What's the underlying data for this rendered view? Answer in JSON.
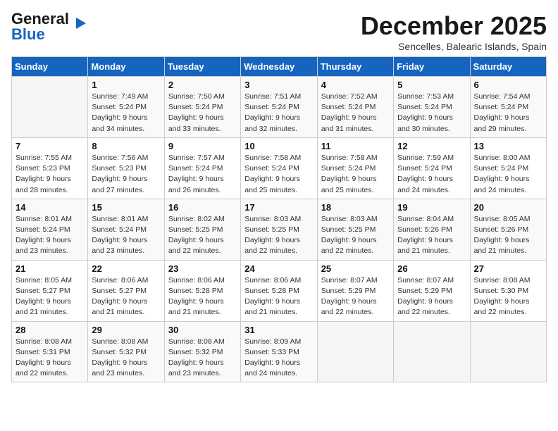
{
  "header": {
    "logo_general": "General",
    "logo_blue": "Blue",
    "title": "December 2025",
    "subtitle": "Sencelles, Balearic Islands, Spain"
  },
  "calendar": {
    "days_of_week": [
      "Sunday",
      "Monday",
      "Tuesday",
      "Wednesday",
      "Thursday",
      "Friday",
      "Saturday"
    ],
    "weeks": [
      [
        {
          "date": "",
          "info": ""
        },
        {
          "date": "1",
          "info": "Sunrise: 7:49 AM\nSunset: 5:24 PM\nDaylight: 9 hours\nand 34 minutes."
        },
        {
          "date": "2",
          "info": "Sunrise: 7:50 AM\nSunset: 5:24 PM\nDaylight: 9 hours\nand 33 minutes."
        },
        {
          "date": "3",
          "info": "Sunrise: 7:51 AM\nSunset: 5:24 PM\nDaylight: 9 hours\nand 32 minutes."
        },
        {
          "date": "4",
          "info": "Sunrise: 7:52 AM\nSunset: 5:24 PM\nDaylight: 9 hours\nand 31 minutes."
        },
        {
          "date": "5",
          "info": "Sunrise: 7:53 AM\nSunset: 5:24 PM\nDaylight: 9 hours\nand 30 minutes."
        },
        {
          "date": "6",
          "info": "Sunrise: 7:54 AM\nSunset: 5:24 PM\nDaylight: 9 hours\nand 29 minutes."
        }
      ],
      [
        {
          "date": "7",
          "info": "Sunrise: 7:55 AM\nSunset: 5:23 PM\nDaylight: 9 hours\nand 28 minutes."
        },
        {
          "date": "8",
          "info": "Sunrise: 7:56 AM\nSunset: 5:23 PM\nDaylight: 9 hours\nand 27 minutes."
        },
        {
          "date": "9",
          "info": "Sunrise: 7:57 AM\nSunset: 5:24 PM\nDaylight: 9 hours\nand 26 minutes."
        },
        {
          "date": "10",
          "info": "Sunrise: 7:58 AM\nSunset: 5:24 PM\nDaylight: 9 hours\nand 25 minutes."
        },
        {
          "date": "11",
          "info": "Sunrise: 7:58 AM\nSunset: 5:24 PM\nDaylight: 9 hours\nand 25 minutes."
        },
        {
          "date": "12",
          "info": "Sunrise: 7:59 AM\nSunset: 5:24 PM\nDaylight: 9 hours\nand 24 minutes."
        },
        {
          "date": "13",
          "info": "Sunrise: 8:00 AM\nSunset: 5:24 PM\nDaylight: 9 hours\nand 24 minutes."
        }
      ],
      [
        {
          "date": "14",
          "info": "Sunrise: 8:01 AM\nSunset: 5:24 PM\nDaylight: 9 hours\nand 23 minutes."
        },
        {
          "date": "15",
          "info": "Sunrise: 8:01 AM\nSunset: 5:24 PM\nDaylight: 9 hours\nand 23 minutes."
        },
        {
          "date": "16",
          "info": "Sunrise: 8:02 AM\nSunset: 5:25 PM\nDaylight: 9 hours\nand 22 minutes."
        },
        {
          "date": "17",
          "info": "Sunrise: 8:03 AM\nSunset: 5:25 PM\nDaylight: 9 hours\nand 22 minutes."
        },
        {
          "date": "18",
          "info": "Sunrise: 8:03 AM\nSunset: 5:25 PM\nDaylight: 9 hours\nand 22 minutes."
        },
        {
          "date": "19",
          "info": "Sunrise: 8:04 AM\nSunset: 5:26 PM\nDaylight: 9 hours\nand 21 minutes."
        },
        {
          "date": "20",
          "info": "Sunrise: 8:05 AM\nSunset: 5:26 PM\nDaylight: 9 hours\nand 21 minutes."
        }
      ],
      [
        {
          "date": "21",
          "info": "Sunrise: 8:05 AM\nSunset: 5:27 PM\nDaylight: 9 hours\nand 21 minutes."
        },
        {
          "date": "22",
          "info": "Sunrise: 8:06 AM\nSunset: 5:27 PM\nDaylight: 9 hours\nand 21 minutes."
        },
        {
          "date": "23",
          "info": "Sunrise: 8:06 AM\nSunset: 5:28 PM\nDaylight: 9 hours\nand 21 minutes."
        },
        {
          "date": "24",
          "info": "Sunrise: 8:06 AM\nSunset: 5:28 PM\nDaylight: 9 hours\nand 21 minutes."
        },
        {
          "date": "25",
          "info": "Sunrise: 8:07 AM\nSunset: 5:29 PM\nDaylight: 9 hours\nand 22 minutes."
        },
        {
          "date": "26",
          "info": "Sunrise: 8:07 AM\nSunset: 5:29 PM\nDaylight: 9 hours\nand 22 minutes."
        },
        {
          "date": "27",
          "info": "Sunrise: 8:08 AM\nSunset: 5:30 PM\nDaylight: 9 hours\nand 22 minutes."
        }
      ],
      [
        {
          "date": "28",
          "info": "Sunrise: 8:08 AM\nSunset: 5:31 PM\nDaylight: 9 hours\nand 22 minutes."
        },
        {
          "date": "29",
          "info": "Sunrise: 8:08 AM\nSunset: 5:32 PM\nDaylight: 9 hours\nand 23 minutes."
        },
        {
          "date": "30",
          "info": "Sunrise: 8:08 AM\nSunset: 5:32 PM\nDaylight: 9 hours\nand 23 minutes."
        },
        {
          "date": "31",
          "info": "Sunrise: 8:09 AM\nSunset: 5:33 PM\nDaylight: 9 hours\nand 24 minutes."
        },
        {
          "date": "",
          "info": ""
        },
        {
          "date": "",
          "info": ""
        },
        {
          "date": "",
          "info": ""
        }
      ]
    ]
  }
}
